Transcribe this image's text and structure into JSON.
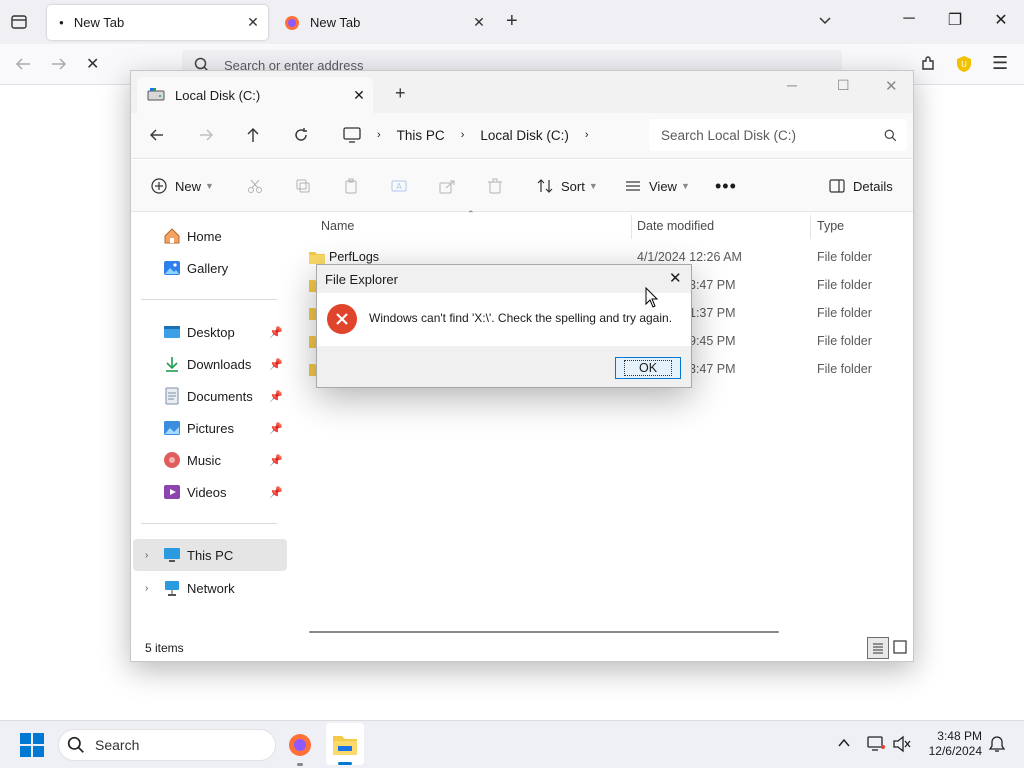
{
  "browser": {
    "tabs": [
      {
        "title": "New Tab",
        "active": true
      },
      {
        "title": "New Tab",
        "active": false
      }
    ],
    "address_placeholder": "Search or enter address"
  },
  "explorer": {
    "tab_title": "Local Disk (C:)",
    "breadcrumb": [
      "This PC",
      "Local Disk (C:)"
    ],
    "search_placeholder": "Search Local Disk (C:)",
    "commands": {
      "new": "New",
      "sort": "Sort",
      "view": "View",
      "details": "Details"
    },
    "nav": {
      "top": [
        {
          "label": "Home",
          "icon": "home-icon"
        },
        {
          "label": "Gallery",
          "icon": "gallery-icon"
        }
      ],
      "quick": [
        {
          "label": "Desktop",
          "icon": "desktop-icon"
        },
        {
          "label": "Downloads",
          "icon": "downloads-icon"
        },
        {
          "label": "Documents",
          "icon": "documents-icon"
        },
        {
          "label": "Pictures",
          "icon": "pictures-icon"
        },
        {
          "label": "Music",
          "icon": "music-icon"
        },
        {
          "label": "Videos",
          "icon": "videos-icon"
        }
      ],
      "bottom": [
        {
          "label": "This PC",
          "icon": "this-pc-icon",
          "selected": true
        },
        {
          "label": "Network",
          "icon": "network-icon"
        }
      ]
    },
    "columns": {
      "name": "Name",
      "date": "Date modified",
      "type": "Type"
    },
    "files": [
      {
        "name": "PerfLogs",
        "date": "4/1/2024 12:26 AM",
        "type": "File folder"
      },
      {
        "name": "",
        "date": "3:47 PM",
        "type": "File folder"
      },
      {
        "name": "",
        "date": "1:37 PM",
        "type": "File folder"
      },
      {
        "name": "",
        "date": "9:45 PM",
        "type": "File folder"
      },
      {
        "name": "",
        "date": "3:47 PM",
        "type": "File folder"
      }
    ],
    "status": "5 items"
  },
  "dialog": {
    "title": "File Explorer",
    "message": "Windows can't find 'X:\\'. Check the spelling and try again.",
    "ok": "OK",
    "icon": "error-icon"
  },
  "taskbar": {
    "search_placeholder": "Search",
    "time": "3:48 PM",
    "date": "12/6/2024"
  },
  "colors": {
    "accent": "#0078d4",
    "error": "#e0442a",
    "folder": "#f7c948",
    "browser_tabbar": "#f0f0f4",
    "taskbar": "#eef0f5"
  }
}
